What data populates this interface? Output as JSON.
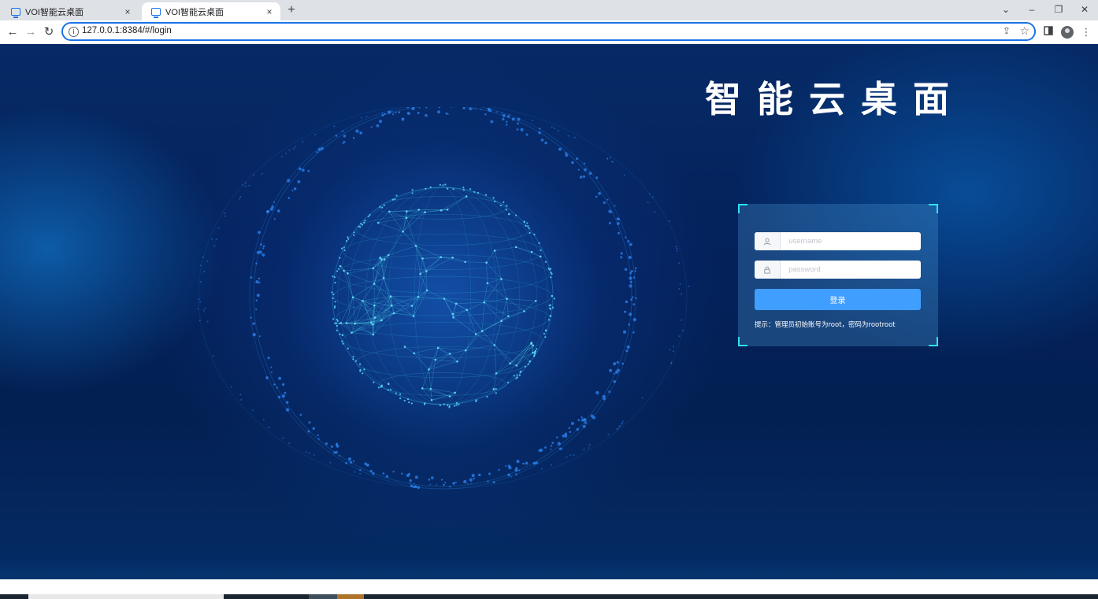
{
  "browser": {
    "tabs": [
      {
        "title": "VOI智能云桌面",
        "close": "×",
        "active": false
      },
      {
        "title": "VOI智能云桌面",
        "close": "×",
        "active": true
      }
    ],
    "new_tab": "+",
    "window_controls": {
      "chevron": "⌄",
      "minimize": "–",
      "restore": "❐",
      "close": "✕"
    },
    "nav": {
      "back": "←",
      "forward": "→",
      "reload": "↻"
    },
    "address": "127.0.0.1:8384/#/login",
    "menu": "⋮"
  },
  "page": {
    "title": "智能云桌面",
    "login": {
      "username_placeholder": "username",
      "password_placeholder": "password",
      "submit_label": "登录",
      "hint": "提示：管理员初始账号为root，密码为rootroot"
    }
  },
  "colors": {
    "accent": "#409eff",
    "corner": "#2fe0f0",
    "globe": "#3aa9ff"
  }
}
